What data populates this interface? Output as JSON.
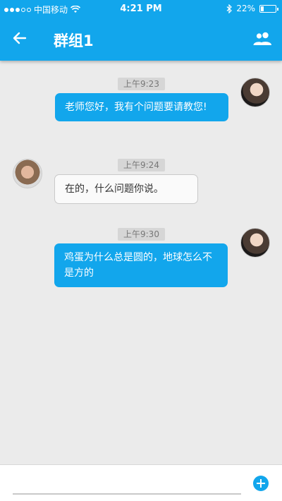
{
  "status_bar": {
    "carrier": "中国移动",
    "time": "4:21 PM",
    "battery": "22%",
    "battery_level": 0.22
  },
  "header": {
    "back_icon": "arrow-left-icon",
    "title": "群组1",
    "group_icon": "people-icon"
  },
  "messages": [
    {
      "time": "上午9:23",
      "side": "right",
      "text": "老师您好，我有个问题要请教您!"
    },
    {
      "time": "上午9:24",
      "side": "left",
      "text": "在的，什么问题你说。"
    },
    {
      "time": "上午9:30",
      "side": "right",
      "text": "鸡蛋为什么总是圆的，地球怎么不是方的"
    }
  ],
  "composer": {
    "placeholder": "",
    "add_icon": "plus-circle-icon"
  },
  "colors": {
    "accent": "#12a6ec",
    "background": "#ebebeb"
  }
}
